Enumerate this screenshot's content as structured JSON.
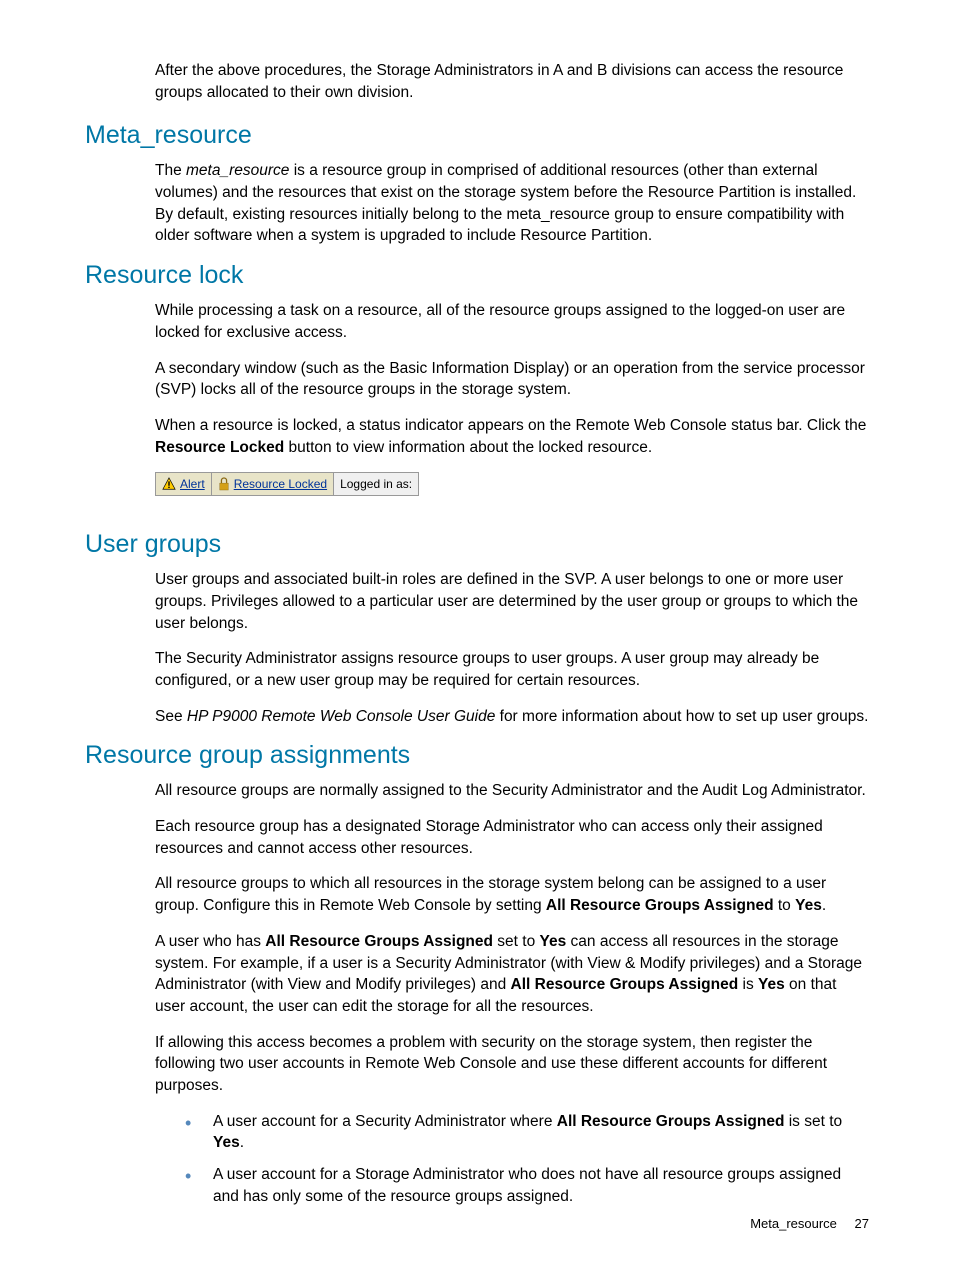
{
  "intro": "After the above procedures, the Storage Administrators in A and B divisions can access the resource groups allocated to their own division.",
  "sections": {
    "metaResource": {
      "heading": "Meta_resource",
      "p1a": "The ",
      "p1b": "meta_resource",
      "p1c": " is a resource group in comprised of additional resources (other than external volumes) and the resources that exist on the storage system before the Resource Partition is installed. By default, existing resources initially belong to the meta_resource group to ensure compatibility with older software when a system is upgraded to include Resource Partition."
    },
    "resourceLock": {
      "heading": "Resource lock",
      "p1": "While processing a task on a resource, all of the resource groups assigned to the logged-on user are locked for exclusive access.",
      "p2": "A secondary window (such as the Basic Information Display) or an operation from the service processor (SVP) locks all of the resource groups in the storage system.",
      "p3a": "When a resource is locked, a status indicator appears on the Remote Web Console status bar. Click the ",
      "p3b": "Resource Locked",
      "p3c": " button to view information about the locked resource.",
      "statusBar": {
        "alert": "Alert",
        "resourceLocked": "Resource Locked",
        "loggedInAs": "Logged in as:"
      }
    },
    "userGroups": {
      "heading": "User groups",
      "p1": "User groups and associated built-in roles are defined in the SVP. A user belongs to one or more user groups. Privileges allowed to a particular user are determined by the user group or groups to which the user belongs.",
      "p2": "The Security Administrator assigns resource groups to user groups. A user group may already be configured, or a new user group may be required for certain resources.",
      "p3a": "See ",
      "p3b": "HP P9000 Remote Web Console User Guide",
      "p3c": " for more information about how to set up user groups."
    },
    "resourceGroupAssignments": {
      "heading": "Resource group assignments",
      "p1": "All resource groups are normally assigned to the Security Administrator and the Audit Log Administrator.",
      "p2": "Each resource group has a designated Storage Administrator who can access only their assigned resources and cannot access other resources.",
      "p3a": "All resource groups to which all resources in the storage system belong can be assigned to a user group. Configure this in Remote Web Console by setting ",
      "p3b": "All Resource Groups Assigned",
      "p3c": " to ",
      "p3d": "Yes",
      "p3e": ".",
      "p4a": "A user who has ",
      "p4b": "All Resource Groups Assigned",
      "p4c": " set to ",
      "p4d": "Yes",
      "p4e": " can access all resources in the storage system. For example, if a user is a Security Administrator (with View & Modify privileges) and a Storage Administrator (with View and Modify privileges) and ",
      "p4f": "All Resource Groups Assigned",
      "p4g": " is ",
      "p4h": "Yes",
      "p4i": " on that user account, the user can edit the storage for all the resources.",
      "p5": "If allowing this access becomes a problem with security on the storage system, then register the following two user accounts in Remote Web Console and use these different accounts for different purposes.",
      "li1a": "A user account for a Security Administrator where ",
      "li1b": "All Resource Groups Assigned",
      "li1c": " is set to ",
      "li1d": "Yes",
      "li1e": ".",
      "li2": "A user account for a Storage Administrator who does not have all resource groups assigned and has only some of the resource groups assigned."
    }
  },
  "footer": {
    "label": "Meta_resource",
    "page": "27"
  }
}
